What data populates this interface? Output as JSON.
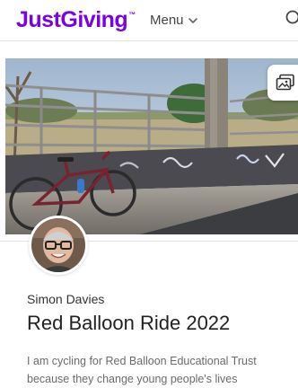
{
  "header": {
    "logo_text": "JustGiving",
    "logo_tm": "™",
    "logo_color": "#7a04dd",
    "menu_label": "Menu",
    "menu_icon": "chevron-down-icon"
  },
  "hero": {
    "gallery_icon": "photo-gallery-icon"
  },
  "owner": {
    "name": "Simon Davies"
  },
  "page": {
    "title": "Red Balloon Ride 2022",
    "story": "I am cycling for Red Balloon Educational Trust because they change young people's lives"
  }
}
